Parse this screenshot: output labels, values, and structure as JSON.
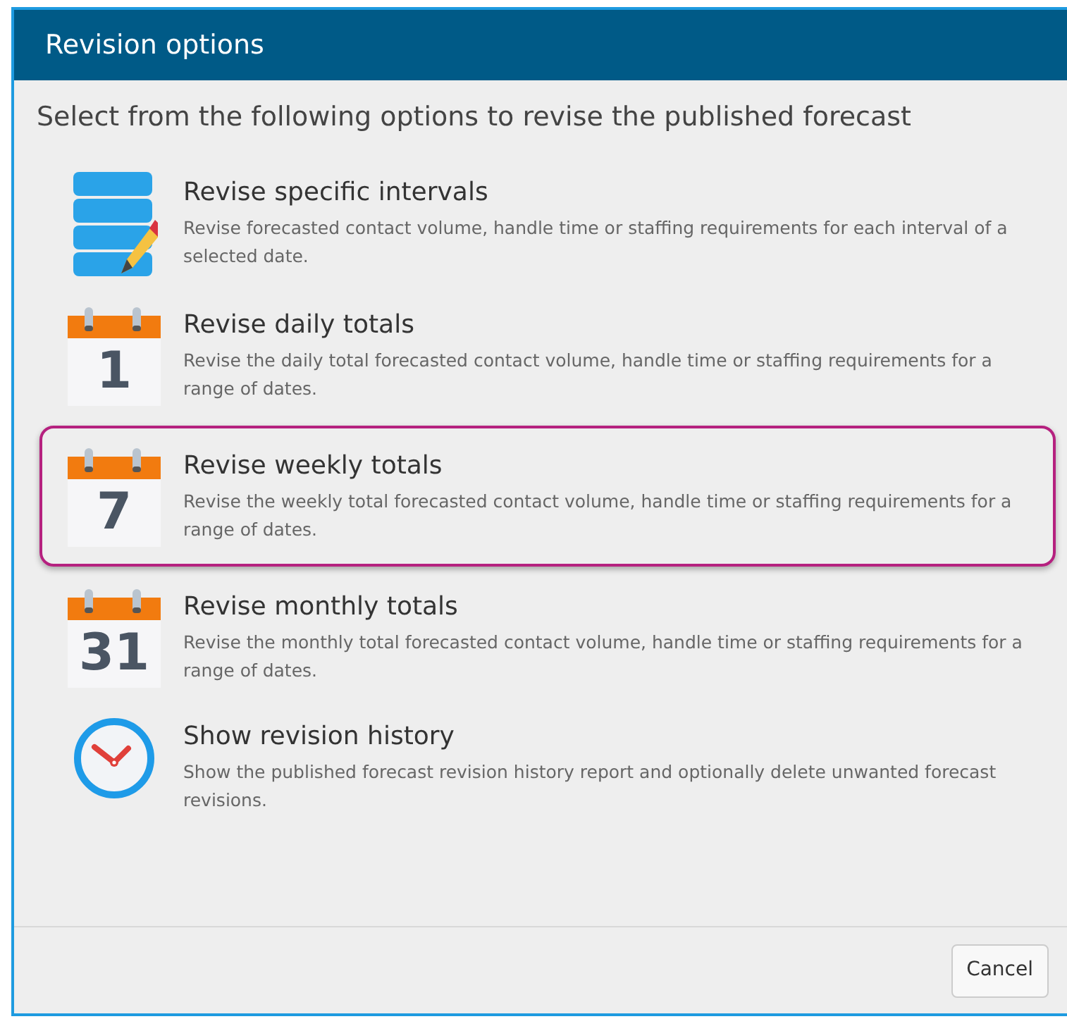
{
  "window": {
    "title": "Revision options"
  },
  "prompt": "Select from the following options to revise the published forecast",
  "options": [
    {
      "kind": "database",
      "title": "Revise specific intervals",
      "description": "Revise forecasted contact volume, handle time or staffing requirements for each interval of a selected date.",
      "selected": false
    },
    {
      "kind": "calendar",
      "day": "1",
      "title": "Revise daily totals",
      "description": "Revise the daily total forecasted contact volume, handle time or staffing requirements for a range of dates.",
      "selected": false
    },
    {
      "kind": "calendar",
      "day": "7",
      "title": "Revise weekly totals",
      "description": "Revise the weekly total forecasted contact volume, handle time or staffing requirements for a range of dates.",
      "selected": true
    },
    {
      "kind": "calendar",
      "day": "31",
      "title": "Revise monthly totals",
      "description": "Revise the monthly total forecasted contact volume, handle time or staffing requirements for a range of dates.",
      "selected": false
    },
    {
      "kind": "clock",
      "title": "Show revision history",
      "description": "Show the published forecast revision history report and optionally delete unwanted forecast revisions.",
      "selected": false
    }
  ],
  "buttons": [
    "Cancel"
  ]
}
